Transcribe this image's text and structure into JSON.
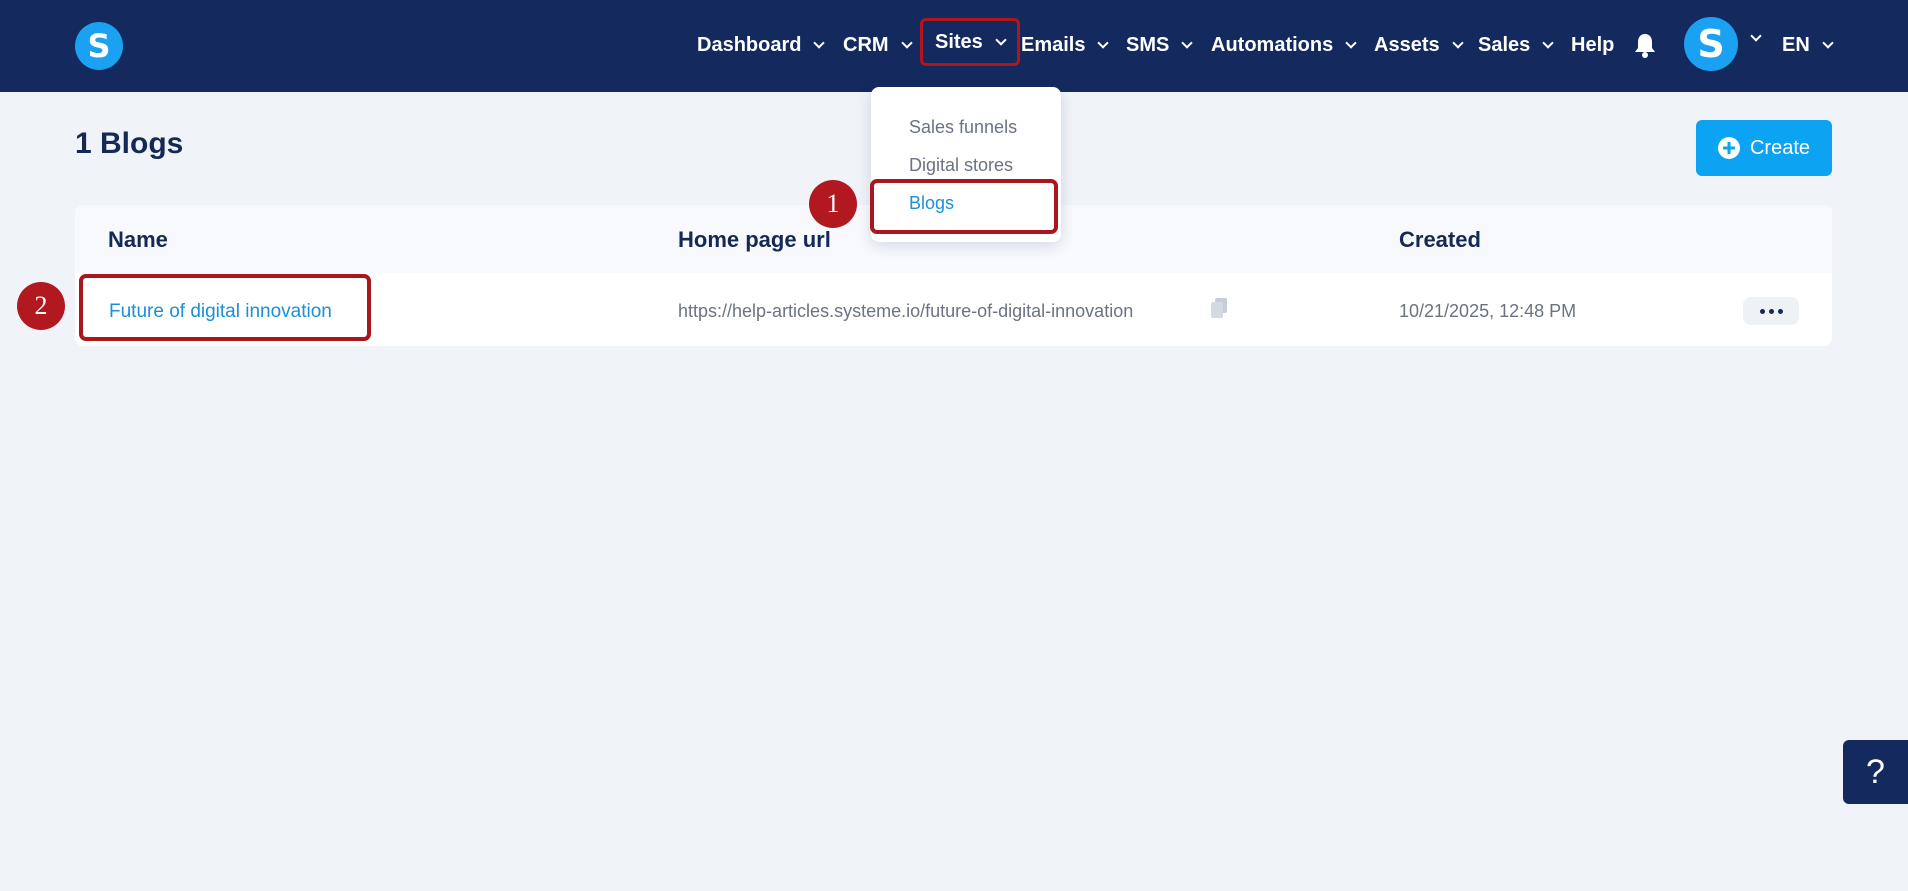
{
  "app": {
    "logo_letter": "S",
    "avatar_letter": "S"
  },
  "nav": {
    "items": [
      {
        "label": "Dashboard",
        "has_chevron": true
      },
      {
        "label": "CRM",
        "has_chevron": true
      },
      {
        "label": "Sites",
        "has_chevron": true,
        "highlighted": true
      },
      {
        "label": "Emails",
        "has_chevron": true
      },
      {
        "label": "SMS",
        "has_chevron": true
      },
      {
        "label": "Automations",
        "has_chevron": true
      },
      {
        "label": "Assets",
        "has_chevron": true
      },
      {
        "label": "Sales",
        "has_chevron": true
      },
      {
        "label": "Help",
        "has_chevron": false
      }
    ],
    "language": "EN",
    "bell_icon": "bell-icon"
  },
  "sites_dropdown": {
    "items": [
      {
        "label": "Sales funnels"
      },
      {
        "label": "Digital stores"
      },
      {
        "label": "Blogs",
        "active": true
      }
    ]
  },
  "page": {
    "title": "1 Blogs",
    "create_label": "Create"
  },
  "table": {
    "headers": {
      "name": "Name",
      "url": "Home page url",
      "created": "Created"
    },
    "rows": [
      {
        "name": "Future of digital innovation",
        "url": "https://help-articles.systeme.io/future-of-digital-innovation",
        "created": "10/21/2025, 12:48 PM"
      }
    ]
  },
  "annotations": {
    "step1": "1",
    "step2": "2"
  },
  "help_widget": "?",
  "colors": {
    "navbar": "#142a5f",
    "accent": "#0ca3f2",
    "link": "#1b8fd8",
    "annotation": "#a8161e"
  }
}
